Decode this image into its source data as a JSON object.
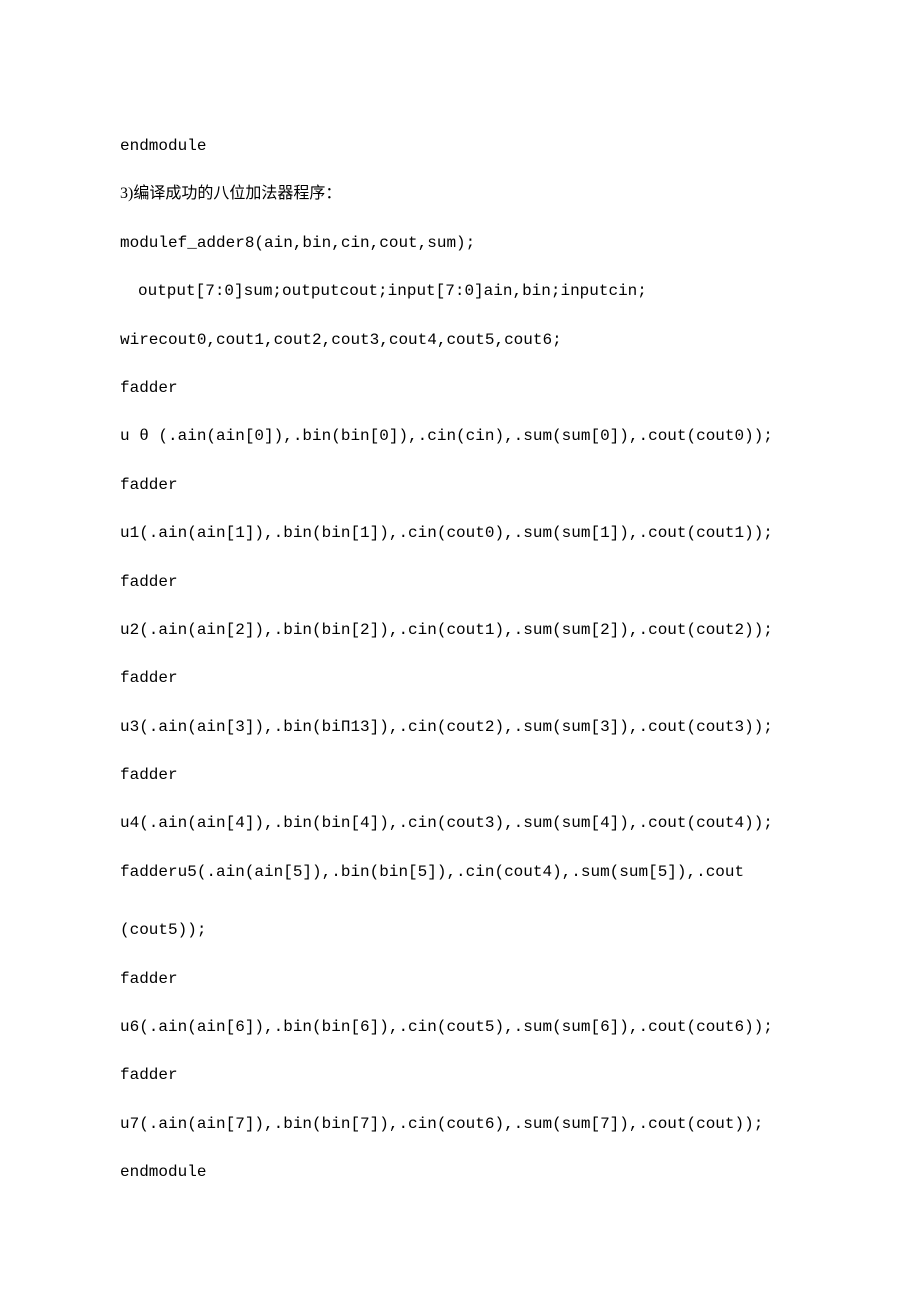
{
  "lines": [
    {
      "text": "endmodule",
      "cls": "line"
    },
    {
      "text": "3)编译成功的八位加法器程序：",
      "cls": "line-cn"
    },
    {
      "text": "modulef_adder8(ain,bin,cin,cout,sum);",
      "cls": "line"
    },
    {
      "text": "output[7:0]sum;outputcout;input[7:0]ain,bin;inputcin;",
      "cls": "line indent1"
    },
    {
      "text": "wirecout0,cout1,cout2,cout3,cout4,cout5,cout6;",
      "cls": "line"
    },
    {
      "text": "fadder",
      "cls": "line"
    },
    {
      "text": "u θ (.ain(ain[0]),.bin(bin[0]),.cin(cin),.sum(sum[0]),.cout(cout0));",
      "cls": "line"
    },
    {
      "text": "fadder",
      "cls": "line"
    },
    {
      "text": "u1(.ain(ain[1]),.bin(bin[1]),.cin(cout0),.sum(sum[1]),.cout(cout1));",
      "cls": "line"
    },
    {
      "text": "fadder",
      "cls": "line"
    },
    {
      "text": "u2(.ain(ain[2]),.bin(bin[2]),.cin(cout1),.sum(sum[2]),.cout(cout2));",
      "cls": "line"
    },
    {
      "text": "fadder",
      "cls": "line"
    },
    {
      "text": "u3(.ain(ain[3]),.bin(biΠ13]),.cin(cout2),.sum(sum[3]),.cout(cout3));",
      "cls": "line"
    },
    {
      "text": "fadder",
      "cls": "line"
    },
    {
      "text": "u4(.ain(ain[4]),.bin(bin[4]),.cin(cout3),.sum(sum[4]),.cout(cout4));",
      "cls": "line"
    },
    {
      "text": "fadderu5(.ain(ain[5]),.bin(bin[5]),.cin(cout4),.sum(sum[5]),.cout",
      "cls": "line"
    },
    {
      "text": "(cout5));",
      "cls": "line gap-top"
    },
    {
      "text": "fadder",
      "cls": "line"
    },
    {
      "text": "u6(.ain(ain[6]),.bin(bin[6]),.cin(cout5),.sum(sum[6]),.cout(cout6));",
      "cls": "line"
    },
    {
      "text": "fadder",
      "cls": "line"
    },
    {
      "text": "u7(.ain(ain[7]),.bin(bin[7]),.cin(cout6),.sum(sum[7]),.cout(cout));",
      "cls": "line"
    },
    {
      "text": "endmodule",
      "cls": "line"
    }
  ]
}
